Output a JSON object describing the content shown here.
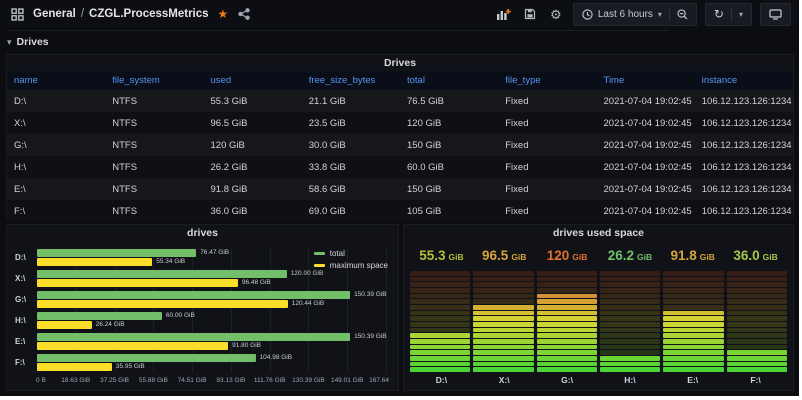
{
  "theme": {
    "accent_orange": "#eb7b18",
    "link_blue": "#5794f2",
    "series_green": "#73bf69",
    "series_yellow": "#fade2a"
  },
  "navbar": {
    "breadcrumb": {
      "section": "General",
      "separator": "/",
      "title": "CZGL.ProcessMetrics"
    },
    "time_range_label": "Last 6 hours",
    "icons": [
      "dashboard-grid",
      "star",
      "share",
      "add-panel",
      "save-dashboard",
      "settings-gear",
      "clock",
      "chevron-down",
      "zoom-out",
      "refresh",
      "tv-kiosk"
    ]
  },
  "dashboard_row": {
    "title": "Drives"
  },
  "table_panel": {
    "title": "Drives",
    "columns": [
      "name",
      "file_system",
      "used",
      "free_size_bytes",
      "total",
      "file_type",
      "Time",
      "instance"
    ],
    "rows": [
      [
        "D:\\",
        "NTFS",
        "55.3 GiB",
        "21.1 GiB",
        "76.5 GiB",
        "Fixed",
        "2021-07-04 19:02:45",
        "106.12.123.126:1234"
      ],
      [
        "X:\\",
        "NTFS",
        "96.5 GiB",
        "23.5 GiB",
        "120 GiB",
        "Fixed",
        "2021-07-04 19:02:45",
        "106.12.123.126:1234"
      ],
      [
        "G:\\",
        "NTFS",
        "120 GiB",
        "30.0 GiB",
        "150 GiB",
        "Fixed",
        "2021-07-04 19:02:45",
        "106.12.123.126:1234"
      ],
      [
        "H:\\",
        "NTFS",
        "26.2 GiB",
        "33.8 GiB",
        "60.0 GiB",
        "Fixed",
        "2021-07-04 19:02:45",
        "106.12.123.126:1234"
      ],
      [
        "E:\\",
        "NTFS",
        "91.8 GiB",
        "58.6 GiB",
        "150 GiB",
        "Fixed",
        "2021-07-04 19:02:45",
        "106.12.123.126:1234"
      ],
      [
        "F:\\",
        "NTFS",
        "36.0 GiB",
        "69.0 GiB",
        "105 GiB",
        "Fixed",
        "2021-07-04 19:02:45",
        "106.12.123.126:1234"
      ]
    ]
  },
  "chart_data": [
    {
      "type": "bar",
      "orientation": "horizontal",
      "title": "drives",
      "categories": [
        "D:\\",
        "X:\\",
        "G:\\",
        "H:\\",
        "E:\\",
        "F:\\"
      ],
      "series": [
        {
          "name": "total",
          "color": "#73bf69",
          "values": [
            76.47,
            120.0,
            150.39,
            60.0,
            150.39,
            104.98
          ],
          "labels": [
            "76.47 GiB",
            "120.00 GiB",
            "150.39 GiB",
            "60.00 GiB",
            "150.39 GiB",
            "104.98 GiB"
          ]
        },
        {
          "name": "maximum space",
          "color": "#fade2a",
          "values": [
            55.34,
            96.48,
            120.44,
            26.24,
            91.8,
            35.95
          ],
          "labels": [
            "55.34 GiB",
            "96.48 GiB",
            "120.44 GiB",
            "26.24 GiB",
            "91.80 GiB",
            "35.95 GiB"
          ]
        }
      ],
      "xlim": [
        0,
        167.64
      ],
      "x_ticks": [
        "0 B",
        "18.63 GiB",
        "37.25 GiB",
        "55.88 GiB",
        "74.51 GiB",
        "93.13 GiB",
        "111.76 GiB",
        "130.39 GiB",
        "149.01 GiB",
        "167.64"
      ],
      "legend_position": "right-top",
      "grid": true
    },
    {
      "type": "bar-gauge",
      "display_mode": "lcd-retro",
      "title": "drives used space",
      "categories": [
        "D:\\",
        "X:\\",
        "G:\\",
        "H:\\",
        "E:\\",
        "F:\\"
      ],
      "values": [
        55.3,
        96.5,
        120,
        26.2,
        91.8,
        36.0
      ],
      "value_texts": [
        "55.3",
        "96.5",
        "120",
        "26.2",
        "91.8",
        "36.0"
      ],
      "unit": "GiB",
      "value_colors": [
        "#b5bd3b",
        "#d7a53d",
        "#e0702f",
        "#73bf69",
        "#d7a53d",
        "#a3c84b"
      ],
      "min": 0,
      "max": 150,
      "segments": 18
    }
  ]
}
